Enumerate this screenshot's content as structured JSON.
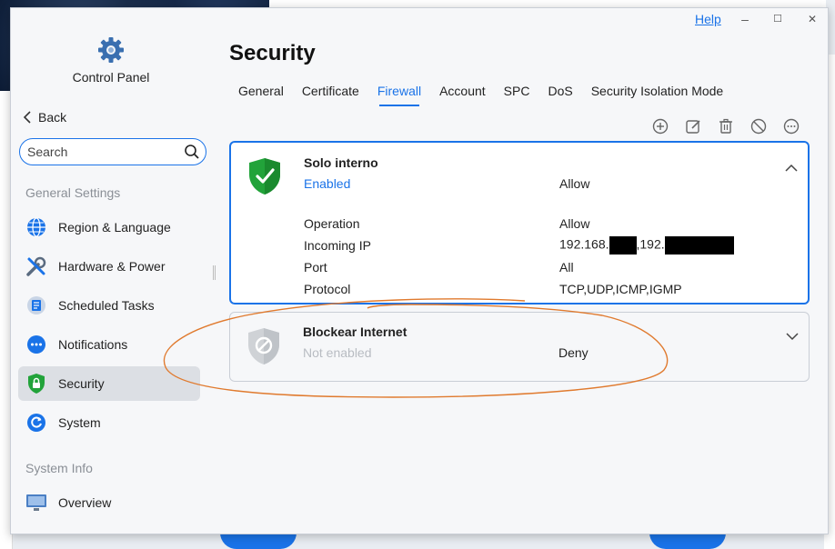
{
  "window": {
    "help": "Help",
    "minimize": "–",
    "maximize": "☐",
    "close": "✕"
  },
  "sidebar": {
    "app_title": "Control Panel",
    "back": "Back",
    "search_placeholder": "Search",
    "general_settings_label": "General Settings",
    "system_info_label": "System Info",
    "items": [
      {
        "label": "Region & Language",
        "icon": "globe-icon"
      },
      {
        "label": "Hardware & Power",
        "icon": "tools-icon"
      },
      {
        "label": "Scheduled Tasks",
        "icon": "tasks-icon"
      },
      {
        "label": "Notifications",
        "icon": "chat-bubble-icon"
      },
      {
        "label": "Security",
        "icon": "shield-lock-icon",
        "active": true
      },
      {
        "label": "System",
        "icon": "refresh-icon"
      },
      {
        "label": "Overview",
        "icon": "monitor-icon"
      }
    ]
  },
  "main": {
    "title": "Security",
    "tabs": [
      "General",
      "Certificate",
      "Firewall",
      "Account",
      "SPC",
      "DoS",
      "Security Isolation Mode"
    ],
    "active_tab": "Firewall",
    "toolbar_icons": [
      "add-icon",
      "edit-icon",
      "delete-icon",
      "disable-icon",
      "more-icon"
    ],
    "rules": [
      {
        "name": "Solo interno",
        "status": "Enabled",
        "action": "Allow",
        "details": {
          "operation_label": "Operation",
          "operation": "Allow",
          "incoming_ip_label": "Incoming IP",
          "incoming_ip_a": "192.168.",
          "incoming_ip_b": ",192.",
          "port_label": "Port",
          "port": "All",
          "protocol_label": "Protocol",
          "protocol": "TCP,UDP,ICMP,IGMP"
        }
      },
      {
        "name": "Blockear Internet",
        "status": "Not enabled",
        "action": "Deny"
      }
    ]
  },
  "colors": {
    "accent": "#1a73e8",
    "enabled": "#1a73e8",
    "disabled": "#b8bcc2",
    "annotation": "#e07a2e",
    "shield_green": "#22a33a"
  }
}
